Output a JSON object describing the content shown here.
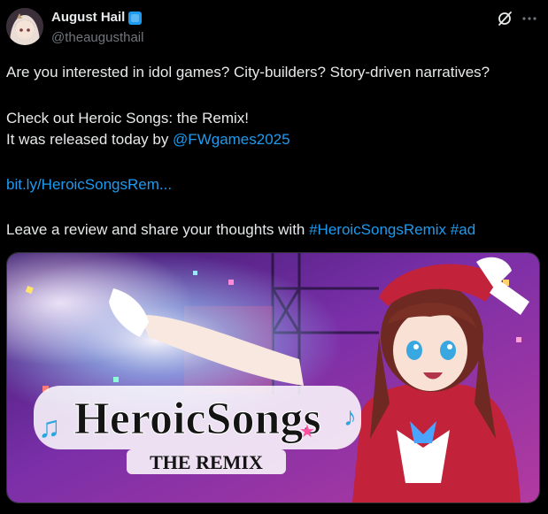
{
  "author": {
    "name": "August Hail",
    "handle": "@theaugusthail"
  },
  "icons": {
    "verified": "verified-badge-icon",
    "grok": "grok-icon",
    "more": "more-icon"
  },
  "tweet": {
    "line1": "Are you interested in idol games? City-builders? Story-driven narratives?",
    "line2": "Check out Heroic Songs: the Remix!",
    "line3_prefix": "It was released today by ",
    "mention": "@FWgames2025",
    "url": "bit.ly/HeroicSongsRem...",
    "line5_prefix": "Leave a review and share your thoughts with ",
    "hashtag1": "#HeroicSongsRemix",
    "hashtag2": "#ad"
  },
  "media": {
    "logo_title": "HeroicSongs",
    "logo_subtitle": "THE REMIX"
  },
  "colors": {
    "background": "#000000",
    "text": "#e7e9ea",
    "secondary": "#71767b",
    "link": "#1d9bf0"
  }
}
